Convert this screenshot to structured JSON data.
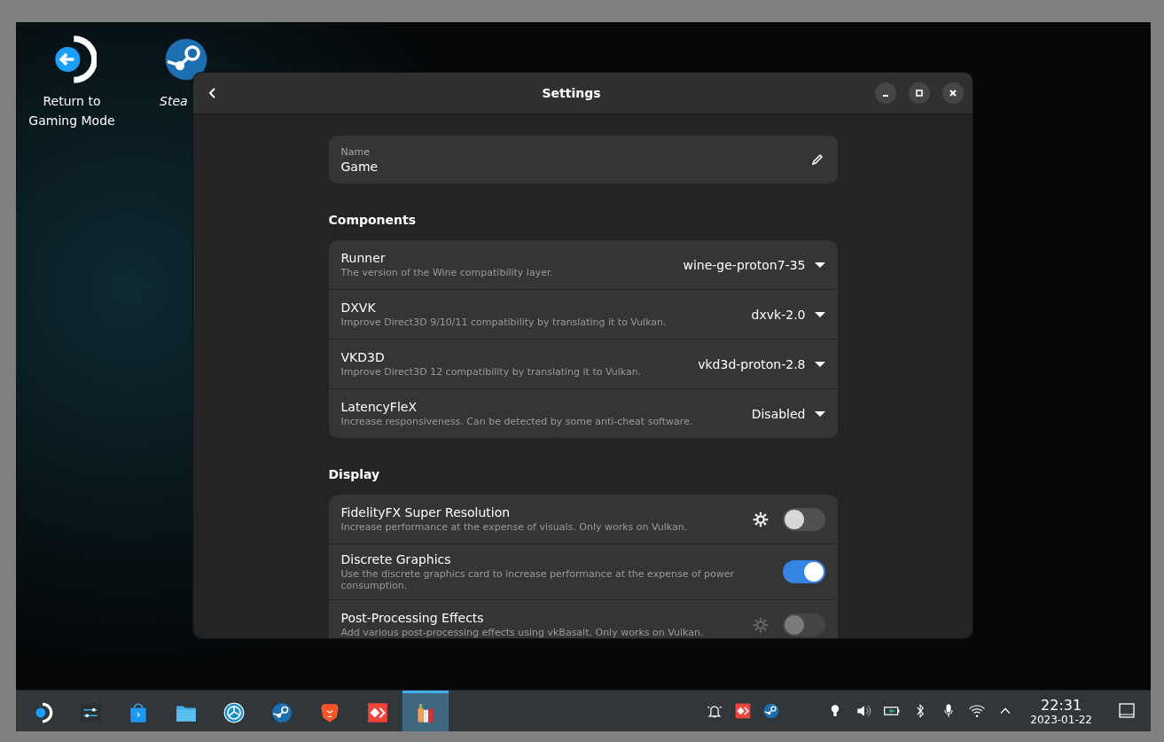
{
  "desktop_icons": [
    {
      "kind": "return",
      "label": "Return to Gaming Mode",
      "italic": false
    },
    {
      "kind": "client",
      "label": "Stea",
      "italic": true
    }
  ],
  "window": {
    "title": "Settings"
  },
  "name_field": {
    "label": "Name",
    "value": "Game"
  },
  "sections": [
    {
      "title": "Components",
      "rows": [
        {
          "kind": "dropdown",
          "title": "Runner",
          "subtitle": "The version of the Wine compatibility layer.",
          "value": "wine-ge-proton7-35"
        },
        {
          "kind": "dropdown",
          "title": "DXVK",
          "subtitle": "Improve Direct3D 9/10/11 compatibility by translating it to Vulkan.",
          "value": "dxvk-2.0"
        },
        {
          "kind": "dropdown",
          "title": "VKD3D",
          "subtitle": "Improve Direct3D 12 compatibility by translating it to Vulkan.",
          "value": "vkd3d-proton-2.8"
        },
        {
          "kind": "dropdown",
          "title": "LatencyFleX",
          "subtitle": "Increase responsiveness. Can be detected by some anti-cheat software.",
          "value": "Disabled"
        }
      ]
    },
    {
      "title": "Display",
      "rows": [
        {
          "kind": "toggle_with_settings",
          "title": "FidelityFX Super Resolution",
          "subtitle": "Increase performance at the expense of visuals. Only works on Vulkan.",
          "on": false,
          "disabled": false
        },
        {
          "kind": "toggle",
          "title": "Discrete Graphics",
          "subtitle": "Use the discrete graphics card to increase performance at the expense of power consumption.",
          "on": true,
          "disabled": false
        },
        {
          "kind": "toggle_with_settings",
          "title": "Post-Processing Effects",
          "subtitle": "Add various post-processing effects using vkBasalt. Only works on Vulkan.",
          "on": false,
          "disabled": true
        }
      ]
    }
  ],
  "taskbar": [
    {
      "kind": "launcher",
      "selected": false
    },
    {
      "kind": "sliders",
      "selected": false
    },
    {
      "kind": "bag",
      "selected": false
    },
    {
      "kind": "folder",
      "selected": false
    },
    {
      "kind": "globe",
      "selected": false
    },
    {
      "kind": "client",
      "selected": false
    },
    {
      "kind": "lion",
      "selected": false
    },
    {
      "kind": "diamond",
      "selected": false
    },
    {
      "kind": "bottles",
      "selected": true
    }
  ],
  "tray": [
    {
      "kind": "bell"
    },
    {
      "kind": "diamond"
    },
    {
      "kind": "client"
    },
    {
      "kind": "bulb"
    },
    {
      "kind": "speaker"
    },
    {
      "kind": "battery"
    },
    {
      "kind": "bluetooth"
    },
    {
      "kind": "mic"
    },
    {
      "kind": "wifi"
    },
    {
      "kind": "caret"
    }
  ],
  "clock": {
    "time": "22:31",
    "date": "2023-01-22"
  }
}
